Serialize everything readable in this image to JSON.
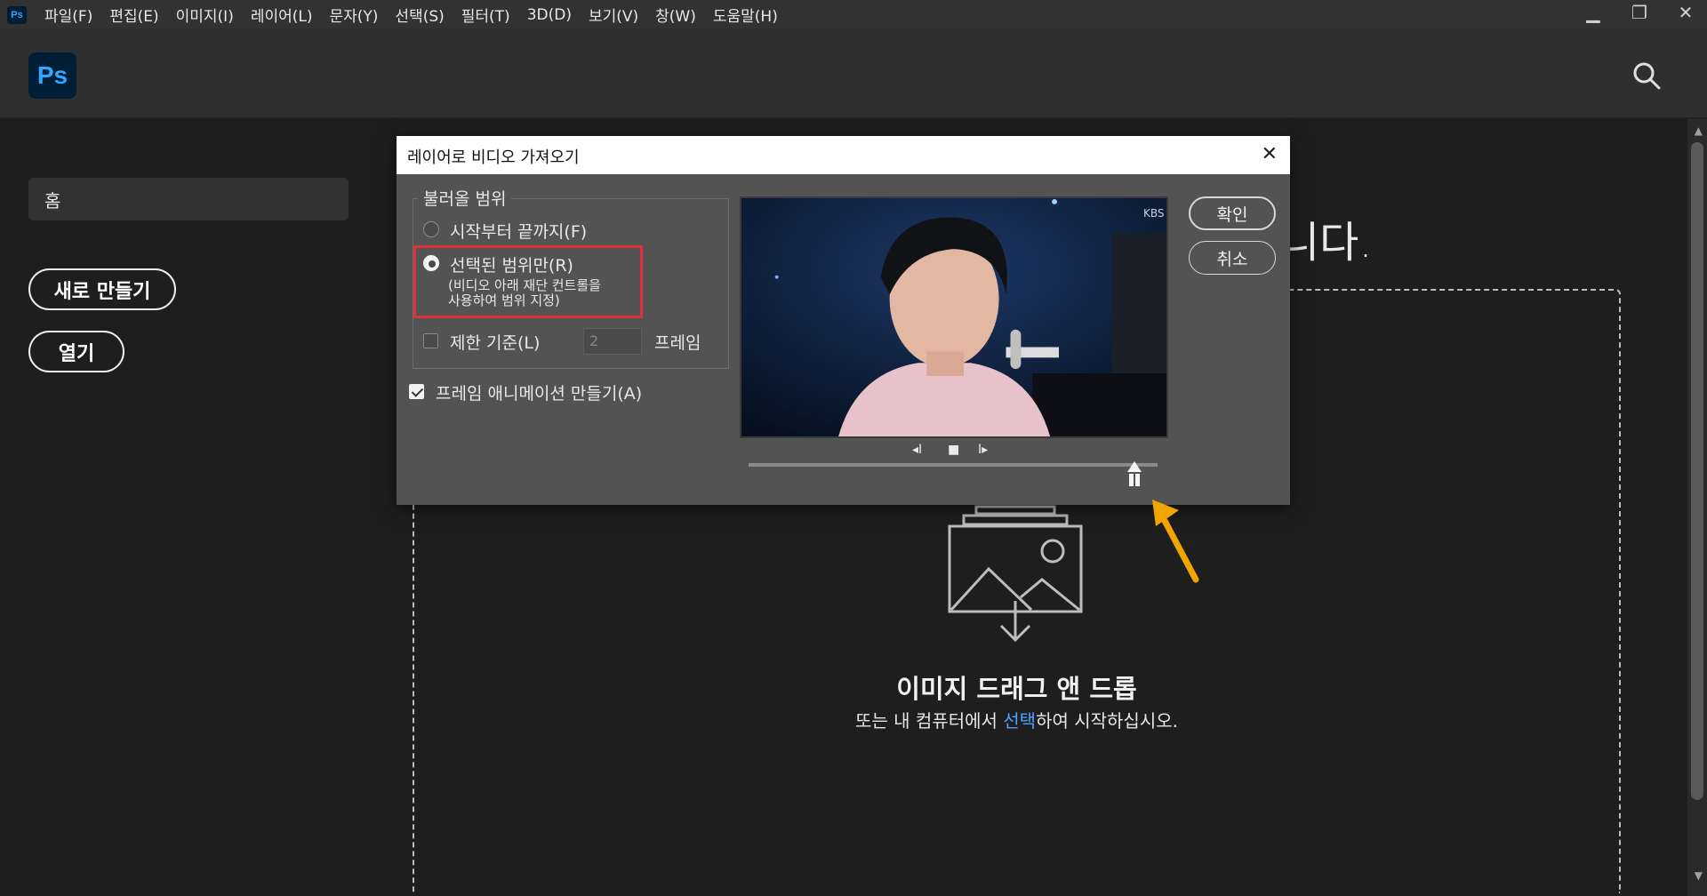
{
  "menubar": {
    "app_badge": "Ps",
    "items": [
      "파일(F)",
      "편집(E)",
      "이미지(I)",
      "레이어(L)",
      "문자(Y)",
      "선택(S)",
      "필터(T)",
      "3D(D)",
      "보기(V)",
      "창(W)",
      "도움말(H)"
    ],
    "window_buttons": {
      "minimize": "▁",
      "restore": "❐",
      "close": "✕"
    }
  },
  "header": {
    "logo": "Ps",
    "search_icon": "search-icon"
  },
  "sidebar": {
    "home": "홈",
    "new_button": "새로 만들기",
    "open_button": "열기"
  },
  "background": {
    "title_fragment": "니다.",
    "drop_title": "이미지 드래그 앤 드롭",
    "drop_sub_before": "또는 내 컴퓨터에서 ",
    "drop_sub_link": "선택",
    "drop_sub_after": "하여 시작하십시오."
  },
  "dialog": {
    "title": "레이어로 비디오 가져오기",
    "group_title": "불러올 범위",
    "option_all": "시작부터 끝까지(F)",
    "option_selected": "선택된 범위만(R)",
    "option_selected_hint_1": "(비디오 아래 재단 컨트롤을",
    "option_selected_hint_2": "사용하여 범위 지정)",
    "limit_label": "제한 기준(L)",
    "limit_value": "2",
    "limit_unit": "프레임",
    "make_animation": "프레임 애니메이션 만들기(A)",
    "ok_button": "확인",
    "cancel_button": "취소",
    "selected_option": "option_selected",
    "make_animation_checked": true,
    "limit_checked": false,
    "preview_badge": "KBS",
    "playback": {
      "prev": "◂I",
      "stop": "■",
      "next": "I▸"
    }
  },
  "colors": {
    "accent_link": "#4da3ff",
    "highlight": "#e0313b",
    "annotation_arrow": "#f0a500"
  }
}
